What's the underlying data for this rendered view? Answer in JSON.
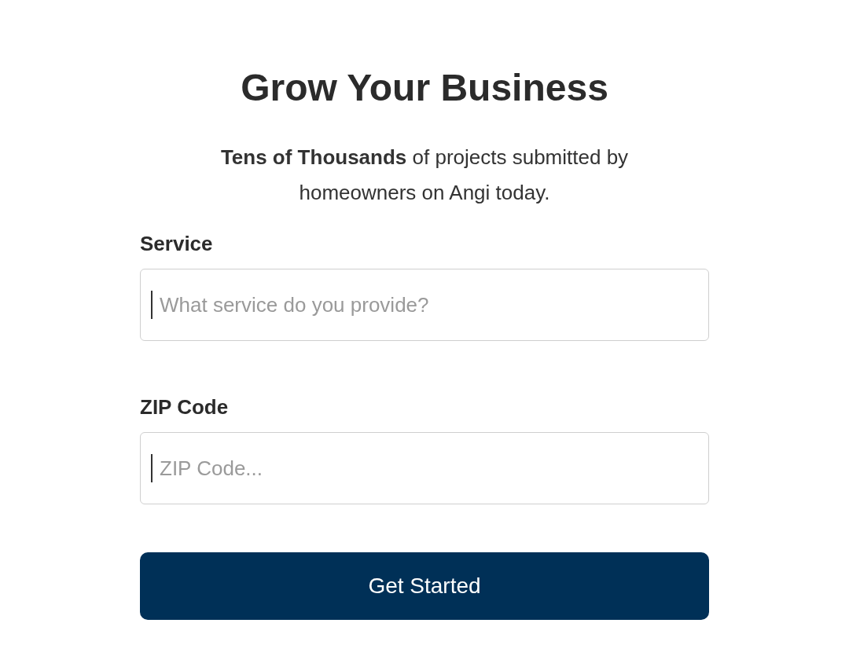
{
  "title": "Grow Your Business",
  "subtitle": "**Tens of Thousands** of projects submitted by homeowners on Angi today.",
  "fields": [
    {
      "label": "Service",
      "placeholder": "What service do you provide?",
      "focused": true
    },
    {
      "label": "ZIP Code",
      "placeholder": "ZIP Code...",
      "focused": true
    }
  ],
  "button": "Get Started"
}
